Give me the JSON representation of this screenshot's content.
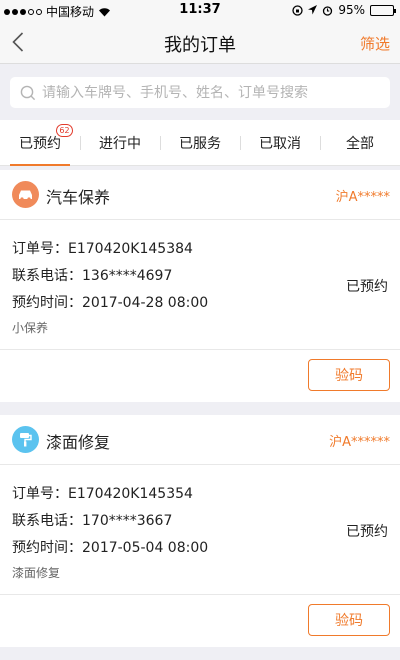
{
  "status_bar": {
    "carrier": "中国移动",
    "time": "11:37",
    "battery": "95%",
    "battery_level": 0.95
  },
  "nav": {
    "title": "我的订单",
    "filter_label": "筛选"
  },
  "search": {
    "placeholder": "请输入车牌号、手机号、姓名、订单号搜索",
    "value": ""
  },
  "tabs": [
    {
      "label": "已预约",
      "badge": "62",
      "active": true
    },
    {
      "label": "进行中"
    },
    {
      "label": "已服务"
    },
    {
      "label": "已取消"
    },
    {
      "label": "全部"
    }
  ],
  "orders": [
    {
      "service": "汽车保养",
      "icon": "car-maintenance-icon",
      "plate": "沪A*****",
      "order_no": "订单号：E170420K145384",
      "phone": "联系电话：136****4697",
      "time": "预约时间：2017-04-28 08:00",
      "tag": "小保养",
      "status": "已预约",
      "action_label": "验码"
    },
    {
      "service": "漆面修复",
      "icon": "paint-repair-icon",
      "plate": "沪A******",
      "order_no": "订单号：E170420K145354",
      "phone": "联系电话：170****3667",
      "time": "预约时间：2017-05-04 08:00",
      "tag": "漆面修复",
      "status": "已预约",
      "action_label": "验码"
    }
  ],
  "colors": {
    "accent": "#f07a2b",
    "badge": "#e23b2c",
    "maintenance_icon_bg": "#f08a5a",
    "paint_icon_bg": "#5bc3ef"
  }
}
